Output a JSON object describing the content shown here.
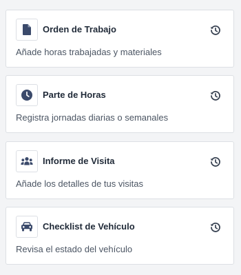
{
  "colors": {
    "icon": "#3b4a6b",
    "title": "#1f2937",
    "description": "#4b5563",
    "history_icon": "#374151",
    "border": "#dcdfe4",
    "background": "#f3f4f6"
  },
  "cards": [
    {
      "icon": "document-icon",
      "title": "Orden de Trabajo",
      "description": "Añade horas trabajadas y materiales",
      "action_icon": "history-icon"
    },
    {
      "icon": "clock-icon",
      "title": "Parte de Horas",
      "description": "Registra jornadas diarias o semanales",
      "action_icon": "history-icon"
    },
    {
      "icon": "people-group-icon",
      "title": "Informe de Visita",
      "description": "Añade los detalles de tus visitas",
      "action_icon": "history-icon"
    },
    {
      "icon": "car-icon",
      "title": "Checklist de Vehículo",
      "description": "Revisa el estado del vehículo",
      "action_icon": "history-icon"
    }
  ]
}
